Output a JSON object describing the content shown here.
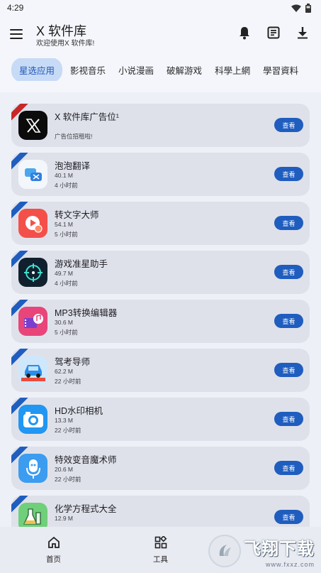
{
  "status": {
    "time": "4:29"
  },
  "header": {
    "title": "X 软件库",
    "subtitle": "欢迎使用X 软件库!"
  },
  "tabs": [
    {
      "label": "星选应用",
      "active": true
    },
    {
      "label": "影视音乐"
    },
    {
      "label": "小说漫画"
    },
    {
      "label": "破解游戏"
    },
    {
      "label": "科學上網"
    },
    {
      "label": "學習資料"
    }
  ],
  "list": {
    "button_label": "查看",
    "items": [
      {
        "name": "X 软件库广告位¹",
        "size": "",
        "time": "广告位招租啦!",
        "ribbon": "#c62828",
        "icon": "x-logo-icon"
      },
      {
        "name": "泡泡翻译",
        "size": "40.1 M",
        "time": "4 小时前",
        "ribbon": "#1f5dbf",
        "icon": "bubble-translate-icon"
      },
      {
        "name": "转文字大师",
        "size": "54.1 M",
        "time": "5 小时前",
        "ribbon": "#1f5dbf",
        "icon": "play-text-icon"
      },
      {
        "name": "游戏准星助手",
        "size": "49.7 M",
        "time": "4 小时前",
        "ribbon": "#1f5dbf",
        "icon": "crosshair-icon"
      },
      {
        "name": "MP3转换编辑器",
        "size": "30.6 M",
        "time": "5 小时前",
        "ribbon": "#1f5dbf",
        "icon": "music-film-icon"
      },
      {
        "name": "驾考导师",
        "size": "62.2 M",
        "time": "22 小时前",
        "ribbon": "#1f5dbf",
        "icon": "car-icon"
      },
      {
        "name": "HD水印相机",
        "size": "13.3 M",
        "time": "22 小时前",
        "ribbon": "#1f5dbf",
        "icon": "camera-icon"
      },
      {
        "name": "特效变音魔术师",
        "size": "20.6 M",
        "time": "22 小时前",
        "ribbon": "#1f5dbf",
        "icon": "microphone-icon"
      },
      {
        "name": "化学方程式大全",
        "size": "12.9 M",
        "time": "",
        "ribbon": "#1f5dbf",
        "icon": "flask-icon"
      }
    ]
  },
  "bottom_nav": [
    {
      "label": "首页",
      "icon": "home-icon"
    },
    {
      "label": "工具",
      "icon": "tools-grid-icon"
    }
  ],
  "watermark": {
    "title": "飞翔下载",
    "sub": "www.fxxz.com"
  }
}
